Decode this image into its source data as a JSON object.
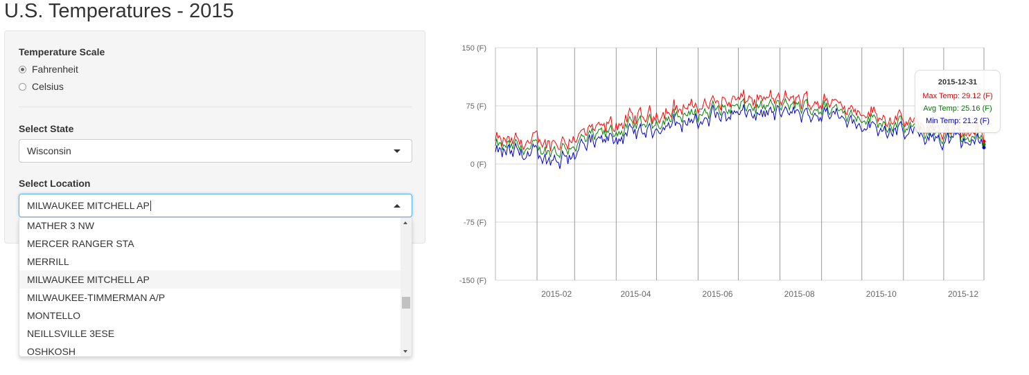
{
  "page_title": "U.S. Temperatures - 2015",
  "sidebar": {
    "scale_label": "Temperature Scale",
    "scale_options": [
      {
        "label": "Fahrenheit",
        "selected": true
      },
      {
        "label": "Celsius",
        "selected": false
      }
    ],
    "state_label": "Select State",
    "state_value": "Wisconsin",
    "location_label": "Select Location",
    "location_value": "MILWAUKEE MITCHELL AP",
    "location_options": [
      "MATHER 3 NW",
      "MERCER RANGER STA",
      "MERRILL",
      "MILWAUKEE MITCHELL AP",
      "MILWAUKEE-TIMMERMAN A/P",
      "MONTELLO",
      "NEILLSVILLE 3ESE",
      "OSHKOSH"
    ],
    "highlighted_option": "MILWAUKEE MITCHELL AP"
  },
  "chart_data": {
    "type": "line",
    "y_ticks": [
      "150 (F)",
      "75 (F)",
      "0 (F)",
      "-75 (F)",
      "-150 (F)"
    ],
    "ylim": [
      -150,
      150
    ],
    "x_ticks": [
      "2015-02",
      "2015-04",
      "2015-06",
      "2015-08",
      "2015-10",
      "2015-12"
    ],
    "x_range": [
      "2015-01-01",
      "2015-12-31"
    ],
    "months": [
      "2015-01",
      "2015-02",
      "2015-03",
      "2015-04",
      "2015-05",
      "2015-06",
      "2015-07",
      "2015-08",
      "2015-09",
      "2015-10",
      "2015-11",
      "2015-12"
    ],
    "series": [
      {
        "label": "Max Temp",
        "color": "#ff0000",
        "monthly_avg": [
          28,
          27,
          42,
          58,
          70,
          79,
          83,
          82,
          78,
          62,
          48,
          40
        ]
      },
      {
        "label": "Avg Temp",
        "color": "#008000",
        "monthly_avg": [
          21,
          17,
          34,
          49,
          61,
          70,
          74,
          74,
          70,
          55,
          42,
          34
        ]
      },
      {
        "label": "Min Temp",
        "color": "#0000cc",
        "monthly_avg": [
          14,
          7,
          26,
          40,
          52,
          61,
          66,
          66,
          62,
          47,
          36,
          28
        ]
      }
    ],
    "grid": true,
    "tooltip": {
      "date": "2015-12-31",
      "lines": [
        "Max Temp: 29.12 (F)",
        "Avg Temp: 25.16 (F)",
        "Min Temp: 21.2 (F)"
      ],
      "values": [
        29.12,
        25.16,
        21.2
      ]
    }
  }
}
